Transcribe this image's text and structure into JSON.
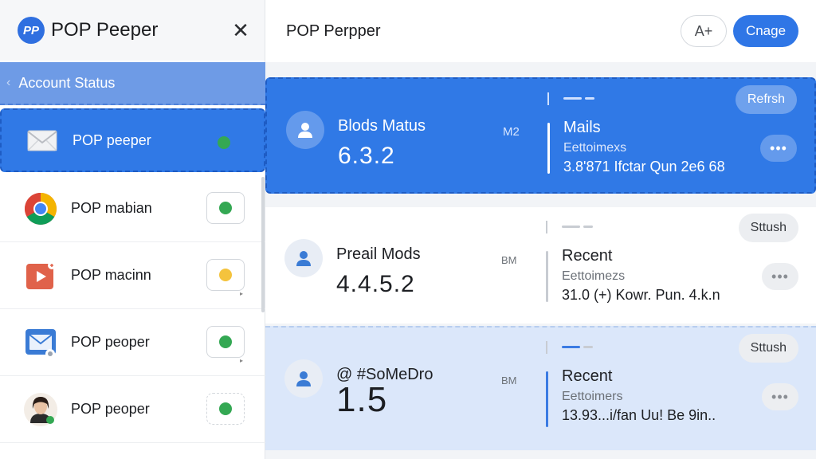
{
  "sidebar": {
    "logo_text": "PP",
    "app_title": "POP Peeper",
    "close_glyph": "✕",
    "section_title": "Account Status",
    "items": [
      {
        "label": "POP peeper",
        "icon": "envelope-icon",
        "status_color": "#34a853",
        "active": true
      },
      {
        "label": "POP mabian",
        "icon": "chrome-icon",
        "status_color": "#34a853",
        "active": false
      },
      {
        "label": "POP macinn",
        "icon": "video-icon",
        "status_color": "#f4c33d",
        "active": false
      },
      {
        "label": "POP peoper",
        "icon": "mail-icon",
        "status_color": "#34a853",
        "active": false
      },
      {
        "label": "POP peoper",
        "icon": "avatar-icon",
        "status_color": "#34a853",
        "active": false
      }
    ]
  },
  "header": {
    "title": "POP Perpper",
    "font_button": "A+",
    "change_button": "Cnage"
  },
  "cards": [
    {
      "title": "Blods Matus",
      "version": "6.3.2",
      "badge": "M2",
      "subtitle": "Mails",
      "caption": "Eettoimexs",
      "detail": "3.8'871 Ifctar Qun 2e6 68",
      "action": "Refrsh",
      "more": "•••",
      "progress_fraction": 0.6
    },
    {
      "title": "Preail Mods",
      "version": "4.4.5.2",
      "badge": "BM",
      "subtitle": "Recent",
      "caption": "Eettoimezs",
      "detail": "31.0 (+) Kowr. Pun. 4.k.n",
      "action": "Sttush",
      "more": "•••",
      "progress_fraction": 0.6
    },
    {
      "title": "@ #SoMeDro",
      "version": "1.5",
      "badge": "BM",
      "subtitle": "Recent",
      "caption": "Eettoimers",
      "detail": "13.93...i/fan Uu! Be 9in..",
      "action": "Sttush",
      "more": "•••",
      "progress_fraction": 0.6
    }
  ],
  "colors": {
    "accent": "#3079e6",
    "accent_dark": "#1e5cc4",
    "status_green": "#34a853",
    "status_yellow": "#f4c33d"
  }
}
